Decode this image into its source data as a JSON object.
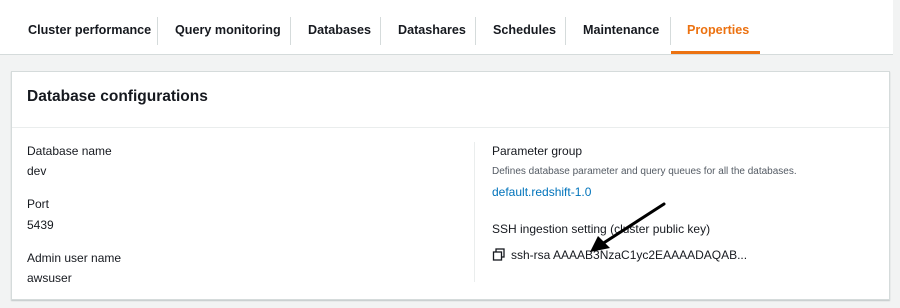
{
  "tabs": [
    {
      "label": "Cluster performance"
    },
    {
      "label": "Query monitoring"
    },
    {
      "label": "Databases"
    },
    {
      "label": "Datashares"
    },
    {
      "label": "Schedules"
    },
    {
      "label": "Maintenance"
    },
    {
      "label": "Properties",
      "active": true
    }
  ],
  "panel": {
    "title": "Database configurations",
    "database_name_label": "Database name",
    "database_name_value": "dev",
    "port_label": "Port",
    "port_value": "5439",
    "admin_user_label": "Admin user name",
    "admin_user_value": "awsuser",
    "parameter_group_label": "Parameter group",
    "parameter_group_desc": "Defines database parameter and query queues for all the databases.",
    "parameter_group_link": "default.redshift-1.0",
    "ssh_label": "SSH ingestion setting (cluster public key)",
    "ssh_value": "ssh-rsa AAAAB3NzaC1yc2EAAAADAQAB..."
  },
  "icons": {
    "copy": "copy-icon",
    "annotation": "arrow-annotation"
  },
  "colors": {
    "accent": "#ec7211",
    "link": "#0073bb"
  }
}
